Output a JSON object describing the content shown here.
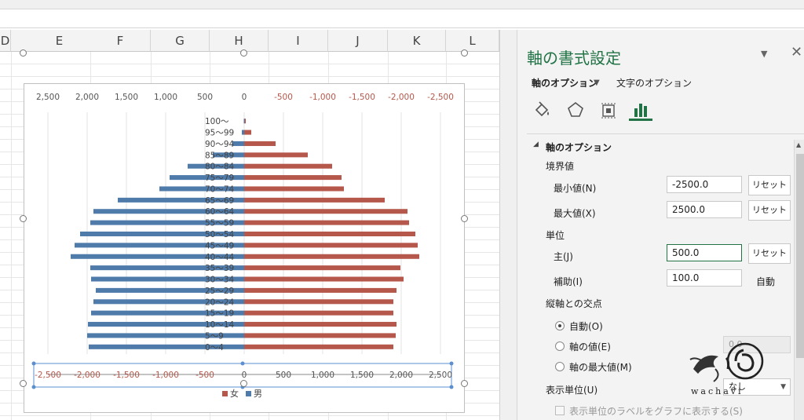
{
  "sheet": {
    "columns": [
      "D",
      "E",
      "F",
      "G",
      "H",
      "I",
      "J",
      "K",
      "L"
    ]
  },
  "chart_data": {
    "type": "bar",
    "orientation": "horizontal",
    "categories": [
      "0～4",
      "5～9",
      "10～14",
      "15～19",
      "20～24",
      "25～29",
      "30～34",
      "35～39",
      "40～44",
      "45～49",
      "50～54",
      "55～59",
      "60～64",
      "65～69",
      "70～74",
      "75～79",
      "80～84",
      "85～89",
      "90～94",
      "95～99",
      "100～"
    ],
    "series": [
      {
        "name": "女",
        "color": "#b5574b",
        "values": [
          1900,
          1930,
          1940,
          1900,
          1900,
          1940,
          2030,
          1990,
          2230,
          2210,
          2180,
          2100,
          2080,
          1790,
          1270,
          1240,
          1120,
          810,
          400,
          90,
          20
        ]
      },
      {
        "name": "男",
        "color": "#4f7bab",
        "values": [
          -1980,
          -2000,
          -1990,
          -1950,
          -1920,
          -1890,
          -1950,
          -1960,
          -2210,
          -2160,
          -2090,
          -1960,
          -1920,
          -1610,
          -1080,
          -950,
          -720,
          -400,
          -150,
          -30,
          -5
        ]
      }
    ],
    "top_axis_ticks": [
      "2,500",
      "2,000",
      "1,500",
      "1,000",
      "500",
      "0",
      "-500",
      "-1,000",
      "-1,500",
      "-2,000",
      "-2,500"
    ],
    "bottom_axis_ticks": [
      "-2,500",
      "-2,000",
      "-1,500",
      "-1,000",
      "-500",
      "0",
      "500",
      "1,000",
      "1,500",
      "2,000",
      "2,500"
    ],
    "xlim": [
      -2500,
      2500
    ],
    "legend": [
      "女",
      "男"
    ],
    "legend_position": "bottom",
    "grid": true
  },
  "pane": {
    "title": "軸の書式設定",
    "tab_axis_options": "軸のオプション",
    "tab_text_options": "文字のオプション",
    "icons": [
      "paint-bucket-icon",
      "pentagon-icon",
      "size-properties-icon",
      "bar-chart-icon"
    ],
    "section_title": "軸のオプション",
    "bounds_label": "境界値",
    "min_label": "最小値(N)",
    "min_value": "-2500.0",
    "max_label": "最大値(X)",
    "max_value": "2500.0",
    "reset_label": "リセット",
    "units_label": "単位",
    "major_label": "主(J)",
    "major_value": "500.0",
    "minor_label": "補助(I)",
    "minor_value": "100.0",
    "minor_status": "自動",
    "cross_label": "縦軸との交点",
    "radio_auto": "自動(O)",
    "radio_value": "軸の値(E)",
    "radio_max": "軸の最大値(M)",
    "axis_value_field": "0.0",
    "display_units_label": "表示単位(U)",
    "display_units_value": "なし",
    "show_units_label": "表示単位のラベルをグラフに表示する(S)"
  },
  "watermark": {
    "text": "wachavi"
  }
}
